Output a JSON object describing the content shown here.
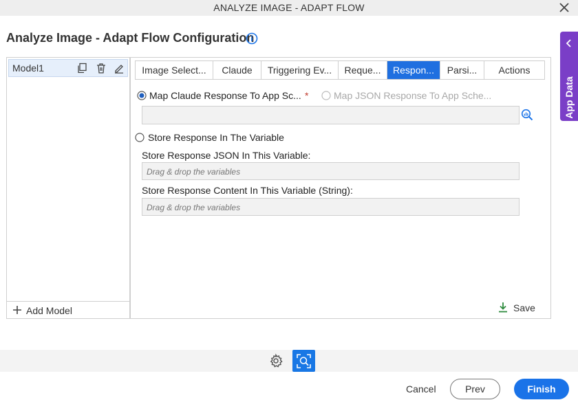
{
  "window": {
    "title": "ANALYZE IMAGE - ADAPT FLOW"
  },
  "page": {
    "title": "Analyze Image - Adapt Flow Configuration"
  },
  "side_tab": {
    "label": "App Data"
  },
  "models": {
    "items": [
      {
        "name": "Model1"
      }
    ],
    "add_label": "Add Model"
  },
  "tabs": [
    {
      "label": "Image Select..."
    },
    {
      "label": "Claude"
    },
    {
      "label": "Triggering Ev..."
    },
    {
      "label": "Reque..."
    },
    {
      "label": "Respon...",
      "active": true
    },
    {
      "label": "Parsi..."
    },
    {
      "label": "Actions"
    }
  ],
  "response": {
    "option_map_claude": "Map Claude Response To App Sc...",
    "option_map_json": "Map JSON Response To App Sche...",
    "mapping_value": "",
    "option_store": "Store Response In The Variable",
    "json_var_label": "Store Response JSON In This Variable:",
    "json_var_placeholder": "Drag & drop the variables",
    "content_var_label": "Store Response Content In This Variable (String):",
    "content_var_placeholder": "Drag & drop the variables",
    "save_label": "Save"
  },
  "footer": {
    "cancel": "Cancel",
    "prev": "Prev",
    "finish": "Finish"
  },
  "colors": {
    "accent": "#1f6fe0",
    "side_tab": "#7a3ec7",
    "save_icon": "#2e8b3e",
    "required": "#c0392b"
  }
}
